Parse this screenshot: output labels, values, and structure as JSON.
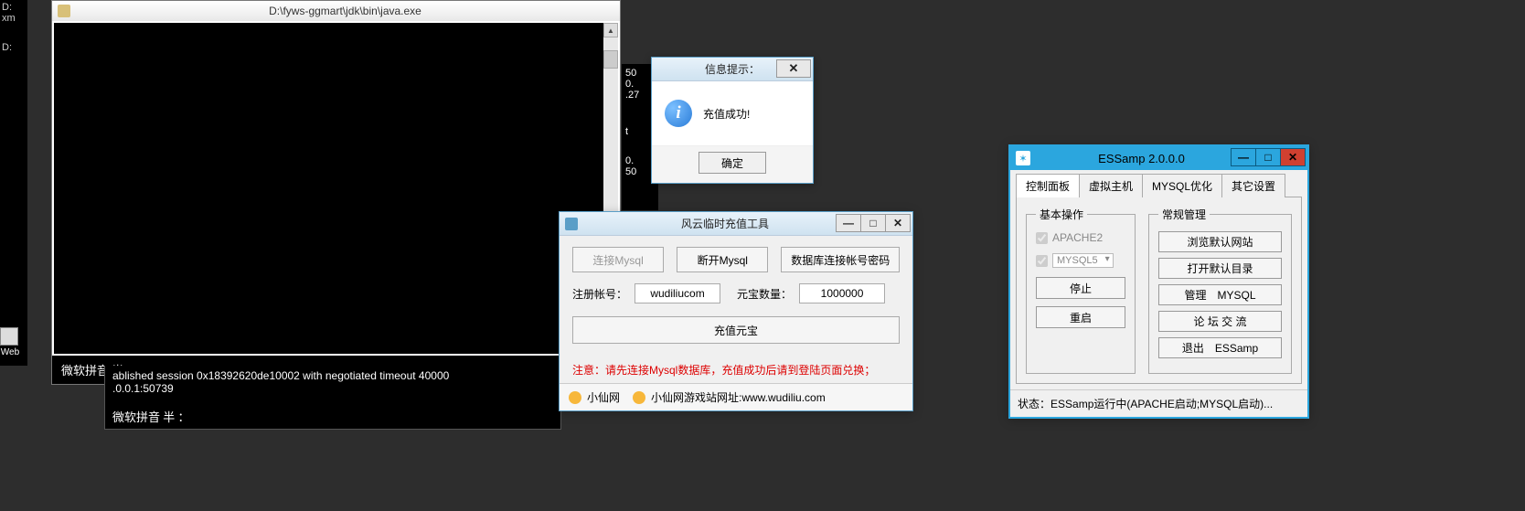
{
  "bg_left": {
    "line1": "D:",
    "line2": "xm",
    "line3": "D:"
  },
  "web_label": "Web",
  "javawin": {
    "title": "D:\\fyws-ggmart\\jdk\\bin\\java.exe",
    "ime": "微软拼音 半 ："
  },
  "lowcon": {
    "line1": "ablished session 0x18392620de10002 with negotiated timeout 40000",
    "line2": ".0.0.1:50739",
    "ime": "微软拼音 半 ："
  },
  "midcon": {
    "l1": "50",
    "l2": "0.",
    "l3": ".27",
    "l4": "t",
    "l5": "0.",
    "l6": "50"
  },
  "infodlg": {
    "title": "信息提示：",
    "message": "充值成功!",
    "ok": "确定"
  },
  "recharge": {
    "title": "风云临时充值工具",
    "btn_connect": "连接Mysql",
    "btn_disconnect": "断开Mysql",
    "btn_dbcreds": "数据库连接帐号密码",
    "label_account": "注册帐号：",
    "value_account": "wudiliucom",
    "label_amount": "元宝数量：",
    "value_amount": "1000000",
    "btn_recharge": "充值元宝",
    "notice": "注意：请先连接Mysql数据库，充值成功后请到登陆页面兑换；",
    "footer_link1": "小仙网",
    "footer_link2": "小仙网游戏站网址:www.wudiliu.com"
  },
  "essamp": {
    "title": "ESSamp 2.0.0.0",
    "tabs": [
      "控制面板",
      "虚拟主机",
      "MYSQL优化",
      "其它设置"
    ],
    "fs_basic": "基本操作",
    "fs_manage": "常规管理",
    "chk_apache": "APACHE2",
    "sel_mysql": "MYSQL5",
    "btn_stop": "停止",
    "btn_restart": "重启",
    "btn_browse": "浏览默认网站",
    "btn_open": "打开默认目录",
    "btn_mysqlmgr": "管理　MYSQL",
    "btn_forum": "论 坛 交 流",
    "btn_exit": "退出　ESSamp",
    "status_label": "状态：",
    "status_text": "ESSamp运行中(APACHE启动;MYSQL启动)..."
  }
}
